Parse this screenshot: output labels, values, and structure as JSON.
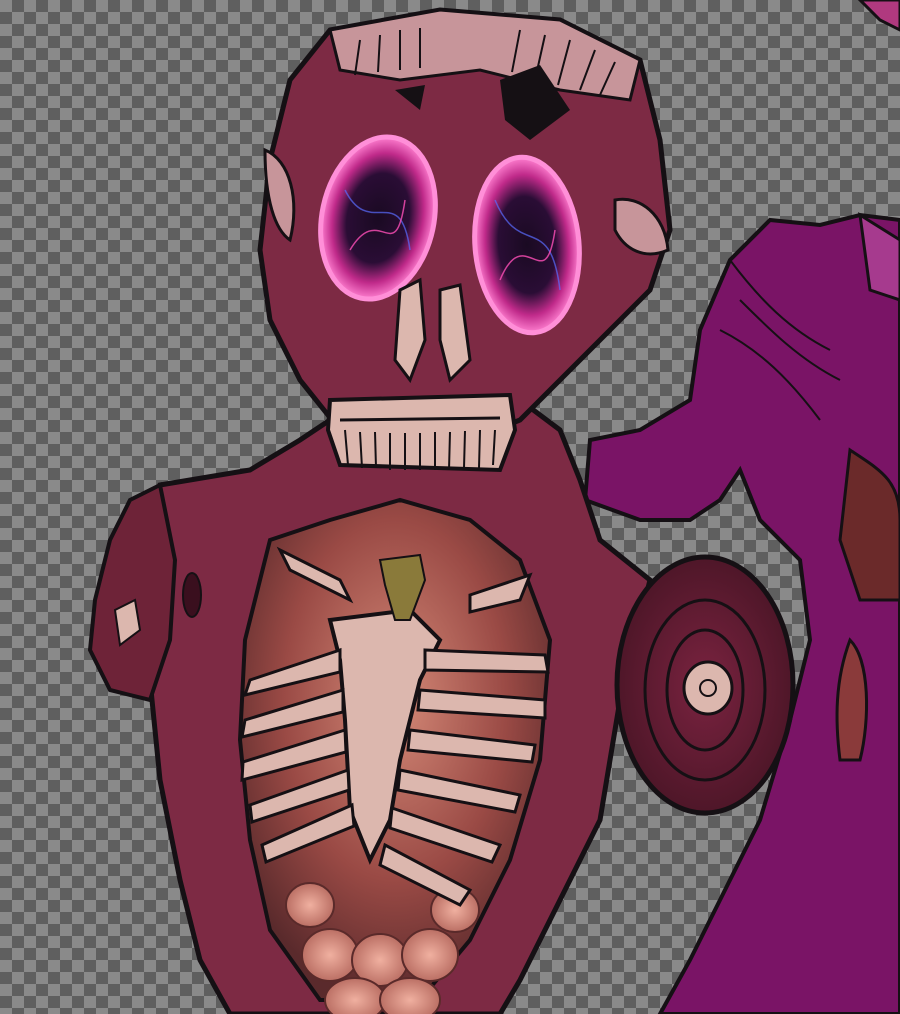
{
  "image": {
    "subject": "horror-illustration",
    "colors": {
      "flesh_dark": "#6e2338",
      "flesh_mid": "#7d2a44",
      "bone": "#dcb7ae",
      "muscle_pink": "#c7959a",
      "glow_pink": "#ff4fb8",
      "glow_blue": "#5a6cff",
      "purple_figure": "#7a1466",
      "organ": "#b56a5c",
      "outline": "#151014"
    }
  }
}
